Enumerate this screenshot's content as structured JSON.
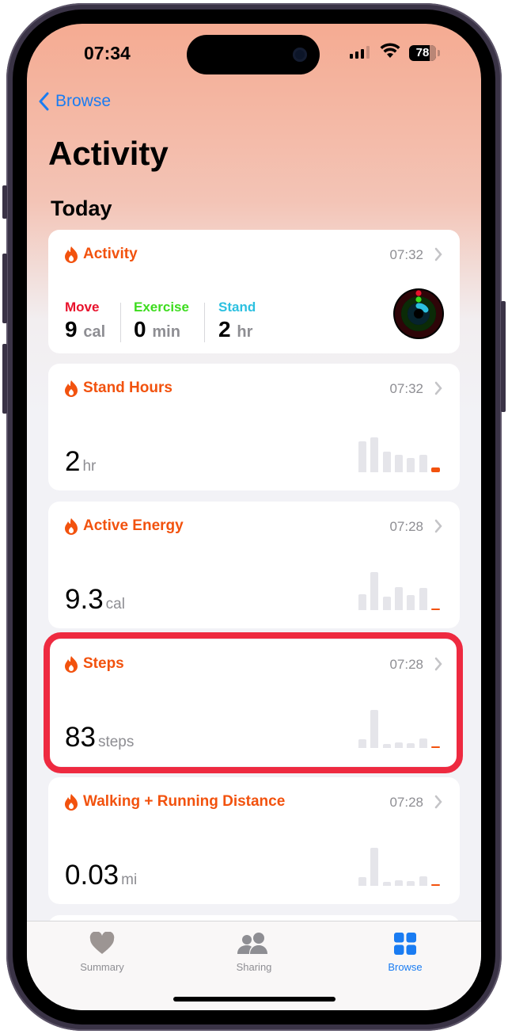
{
  "status_bar": {
    "time": "07:34",
    "battery": "78",
    "signal_icon": "cellular-signal-icon",
    "wifi_icon": "wifi-icon"
  },
  "nav": {
    "back_label": "Browse",
    "title": "Activity",
    "section": "Today"
  },
  "colors": {
    "accent": "#f2520e",
    "link": "#1a7cf2",
    "move": "#e8122c",
    "exercise": "#3ddc1e",
    "stand": "#2cc0e0",
    "highlight": "#ee2a40"
  },
  "cards": {
    "activity": {
      "title": "Activity",
      "time": "07:32",
      "move": {
        "label": "Move",
        "value": "9",
        "unit": "cal"
      },
      "exercise": {
        "label": "Exercise",
        "value": "0",
        "unit": "min"
      },
      "stand": {
        "label": "Stand",
        "value": "2",
        "unit": "hr"
      }
    },
    "stand_hours": {
      "title": "Stand Hours",
      "time": "07:32",
      "value": "2",
      "unit": "hr",
      "trend": [
        0.82,
        0.92,
        0.55,
        0.46,
        0.38,
        0.45,
        0.12
      ]
    },
    "active_energy": {
      "title": "Active Energy",
      "time": "07:28",
      "value": "9.3",
      "unit": "cal",
      "trend": [
        0.42,
        1.0,
        0.36,
        0.6,
        0.4,
        0.58,
        0.03
      ]
    },
    "steps": {
      "title": "Steps",
      "time": "07:28",
      "value": "83",
      "unit": "steps",
      "trend": [
        0.22,
        1.0,
        0.1,
        0.15,
        0.12,
        0.25,
        0.03
      ]
    },
    "walking_running": {
      "title": "Walking + Running Distance",
      "time": "07:28",
      "value": "0.03",
      "unit": "mi",
      "trend": [
        0.22,
        1.0,
        0.1,
        0.15,
        0.12,
        0.25,
        0.03
      ]
    }
  },
  "tabbar": {
    "items": [
      {
        "label": "Summary",
        "icon": "heart-icon",
        "active": false
      },
      {
        "label": "Sharing",
        "icon": "people-icon",
        "active": false
      },
      {
        "label": "Browse",
        "icon": "grid-icon",
        "active": true
      }
    ]
  }
}
